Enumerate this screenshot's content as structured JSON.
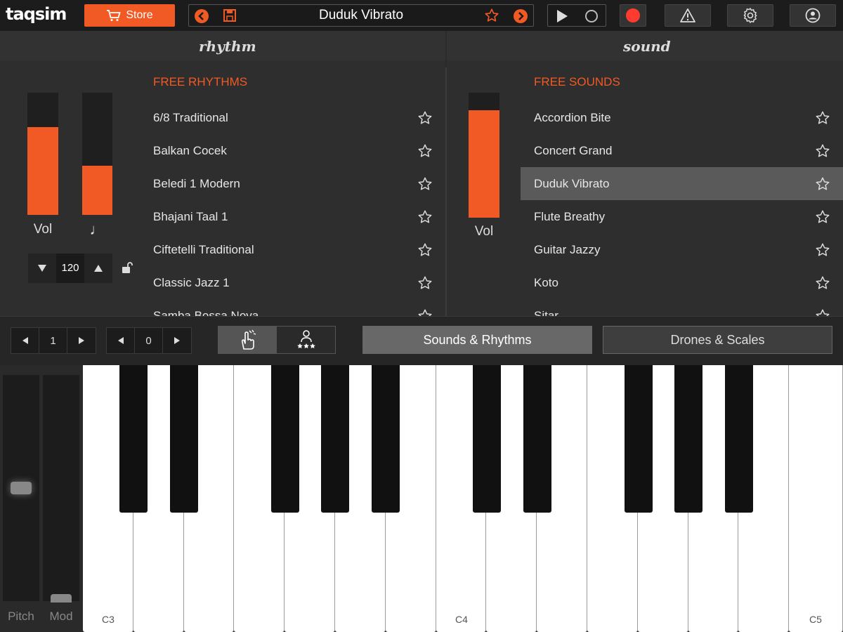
{
  "app": {
    "logo": "taqsim"
  },
  "topbar": {
    "store_label": "Store",
    "preset_name": "Duduk Vibrato",
    "accent": "#f15a24"
  },
  "rhythm": {
    "title": "rhythm",
    "list_header": "FREE RHYTHMS",
    "vol_label": "Vol",
    "note_label": "♩",
    "vol_level": 0.72,
    "tempo_level": 0.4,
    "tempo": "120",
    "items": [
      "6/8 Traditional",
      "Balkan Cocek",
      "Beledi 1 Modern",
      "Bhajani Taal 1",
      "Ciftetelli Traditional",
      "Classic Jazz 1",
      "Samba Bossa Nova"
    ]
  },
  "sound": {
    "title": "sound",
    "list_header": "FREE SOUNDS",
    "vol_label": "Vol",
    "vol_level": 0.86,
    "selected_index": 2,
    "items": [
      "Accordion Bite",
      "Concert Grand",
      "Duduk Vibrato",
      "Flute Breathy",
      "Guitar Jazzy",
      "Koto",
      "Sitar"
    ]
  },
  "controls": {
    "octave_value": "1",
    "transpose_value": "0",
    "tab_sounds": "Sounds & Rhythms",
    "tab_drones": "Drones & Scales"
  },
  "keyboard": {
    "pitch_label": "Pitch",
    "mod_label": "Mod",
    "labels": [
      "C3",
      "C4",
      "C5"
    ]
  }
}
